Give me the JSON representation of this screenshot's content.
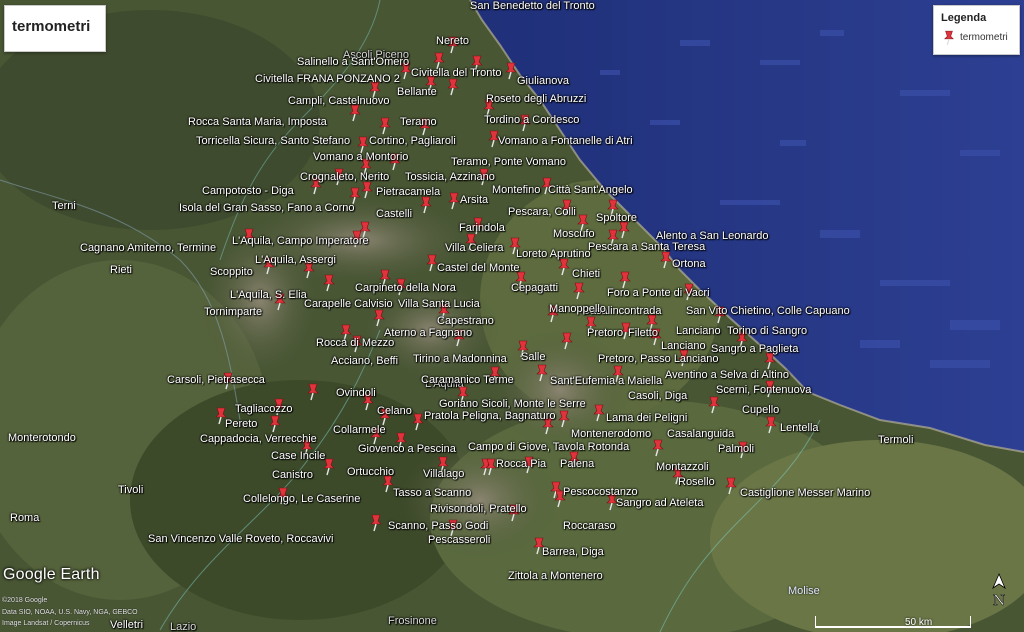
{
  "title": "termometri",
  "legend": {
    "title": "Legenda",
    "item": "termometri"
  },
  "colors": {
    "sea": "#2a3a8a",
    "land": "#4a5a34",
    "pin": "#e0333c"
  },
  "cities": [
    {
      "name": "San Benedetto del Tronto",
      "faint": false
    },
    {
      "name": "Ascoli Piceno",
      "faint": true
    },
    {
      "name": "Terni",
      "faint": false
    },
    {
      "name": "Rieti",
      "faint": false
    },
    {
      "name": "Monterotondo",
      "faint": false
    },
    {
      "name": "Tivoli",
      "faint": false
    },
    {
      "name": "Roma",
      "faint": false
    },
    {
      "name": "Termoli",
      "faint": false
    },
    {
      "name": "Frosinone",
      "faint": true
    },
    {
      "name": "L'Aquila",
      "faint": true
    },
    {
      "name": "Lazio",
      "faint": true
    },
    {
      "name": "Velletri",
      "faint": false
    }
  ],
  "region_molise": "Molise",
  "stations": [
    "Nereto",
    "Salinello a Sant'Omero",
    "Civitella del Tronto",
    "Giulianova",
    "Civitella FRANA PONZANO 2",
    "Bellante",
    "Roseto degli Abruzzi",
    "Campli, Castelnuovo",
    "Tordino a Cordesco",
    "Rocca Santa Maria, Imposta",
    "Teramo",
    "Torricella Sicura, Santo Stefano",
    "Cortino, Pagliaroli",
    "Vomano a Fontanelle di Atri",
    "Vomano a Montorio",
    "Teramo, Ponte Vomano",
    "Crognaleto, Nerito",
    "Tossicia, Azzinano",
    "Montefino",
    "Città Sant'Angelo",
    "Campotosto - Diga",
    "Pietracamela",
    "Arsita",
    "Isola del Gran Sasso, Fano a Corno",
    "Castelli",
    "Pescara, Colli",
    "Spoltore",
    "Farindola",
    "Moscufo",
    "Alento a San Leonardo",
    "L'Aquila, Campo Imperatore",
    "Pescara a Santa Teresa",
    "Cagnano Amiterno, Termine",
    "Villa Celiera",
    "Loreto Aprutino",
    "L'Aquila, Assergi",
    "Ortona",
    "Castel del Monte",
    "Chieti",
    "Scoppito",
    "Carpineto della Nora",
    "Cepagatti",
    "Foro a Ponte di Vacri",
    "L'Aquila, S. Elia",
    "Casalincontrada",
    "Carapelle Calvisio",
    "Villa Santa Lucia",
    "San Vito Chietino, Colle Capuano",
    "Tornimparte",
    "Manoppello",
    "Capestrano",
    "Lanciano",
    "Torino di Sangro",
    "Pretoro",
    "Filetto",
    "Aterno a Fagnano",
    "Lanciano",
    "Sangro a Paglieta",
    "Rocca di Mezzo",
    "Salle",
    "Acciano, Beffi",
    "Pretoro, Passo Lanciano",
    "Tirino a Madonnina",
    "Aventino a Selva di Altino",
    "Caramanico Terme",
    "Sant'Eufemia a Maiella",
    "Scerni, Fontenuova",
    "Carsoli, Pietrasecca",
    "Ovindoli",
    "Casoli, Diga",
    "Goriano Sicoli, Monte le Serre",
    "Cupello",
    "Tagliacozzo",
    "Celano",
    "Pratola Peligna, Bagnaturo",
    "Lama dei Peligni",
    "Lentella",
    "Pereto",
    "Montenerodomo",
    "Casalanguida",
    "Collarmele",
    "Cappadocia, Verrecchie",
    "Giovenco a Pescina",
    "Campo di Giove, Tavola Rotonda",
    "Palmoli",
    "Case Incile",
    "Montazzoli",
    "Ortucchio",
    "Rocca Pia",
    "Palena",
    "Canistro",
    "Villalago",
    "Rosello",
    "Castiglione Messer Marino",
    "Collelongo, Le Caserine",
    "Tasso a Scanno",
    "Pescocostanzo",
    "Sangro ad Ateleta",
    "Rivisondoli, Pratello",
    "San Vincenzo Valle Roveto, Roccavivi",
    "Scanno, Passo Godi",
    "Roccaraso",
    "Pescasseroli",
    "Barrea, Diga",
    "Zittola a Montenero"
  ],
  "brand": "Google Earth",
  "credits": [
    "©2018 Google",
    "Data SIO, NOAA, U.S. Navy, NGA, GEBCO",
    "Image Landsat / Copernicus"
  ],
  "scale": "50 km",
  "north": "N"
}
